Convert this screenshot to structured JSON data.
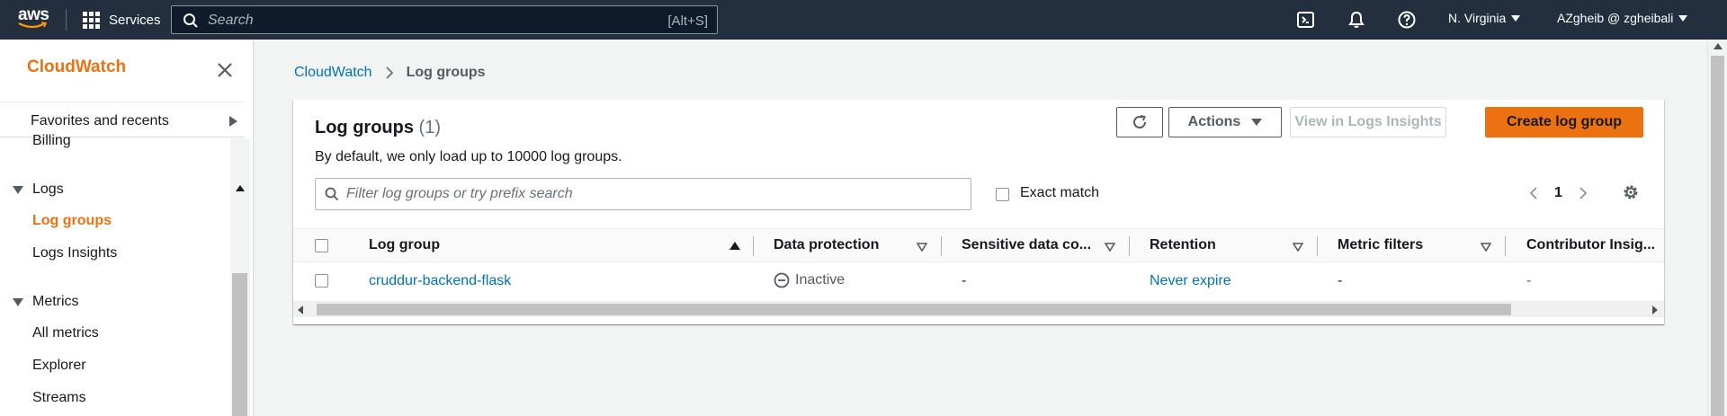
{
  "topnav": {
    "logo_text": "aws",
    "services_label": "Services",
    "search_placeholder": "Search",
    "search_shortcut": "[Alt+S]",
    "icons": [
      "cloudshell-icon",
      "bell-icon",
      "help-icon"
    ],
    "region": "N. Virginia",
    "account": "AZgheib @ zgheibali"
  },
  "sidebar": {
    "title": "CloudWatch",
    "favorites": "Favorites and recents",
    "items_top": [
      "Billing"
    ],
    "logs": {
      "section": "Logs",
      "items": [
        "Log groups",
        "Logs Insights"
      ],
      "active": "Log groups"
    },
    "metrics": {
      "section": "Metrics",
      "items": [
        "All metrics",
        "Explorer",
        "Streams"
      ]
    }
  },
  "breadcrumb": {
    "root": "CloudWatch",
    "current": "Log groups"
  },
  "panel": {
    "title": "Log groups",
    "count": "(1)",
    "description": "By default, we only load up to 10000 log groups.",
    "buttons": {
      "refresh": "refresh-icon",
      "actions": "Actions",
      "view_insights": "View in Logs Insights",
      "create": "Create log group"
    },
    "filter_placeholder": "Filter log groups or try prefix search",
    "exact_match": "Exact match",
    "page": "1",
    "columns": [
      "Log group",
      "Data protection",
      "Sensitive data co...",
      "Retention",
      "Metric filters",
      "Contributor Insig..."
    ],
    "rows": [
      {
        "log_group": "cruddur-backend-flask",
        "data_protection": "Inactive",
        "sensitive": "-",
        "retention": "Never expire",
        "metric_filters": "-",
        "contributor": "-"
      }
    ]
  }
}
